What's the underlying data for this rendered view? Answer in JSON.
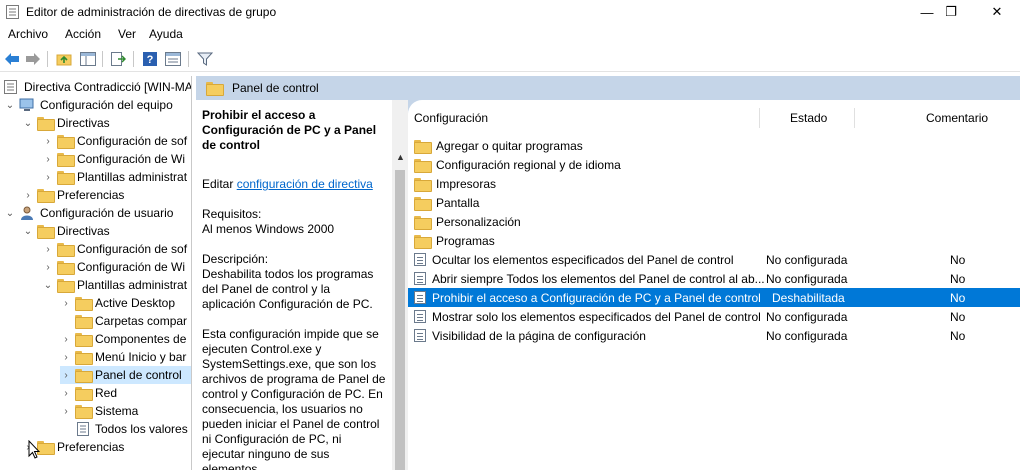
{
  "window": {
    "title": "Editor de administración de directivas de grupo",
    "minimize": "—",
    "maximize": "❐",
    "close": "✕"
  },
  "menu": [
    "Archivo",
    "Acción",
    "Ver",
    "Ayuda"
  ],
  "tree": [
    {
      "label": "Directiva Contradicció [WIN-MA",
      "indent": 0,
      "chevron": "",
      "icon": "policy"
    },
    {
      "label": "Configuración del equipo",
      "indent": 1,
      "chevron": "v",
      "icon": "computer"
    },
    {
      "label": "Directivas",
      "indent": 2,
      "chevron": "v",
      "icon": "folder"
    },
    {
      "label": "Configuración de sof",
      "indent": 3,
      "chevron": ">",
      "icon": "folder"
    },
    {
      "label": "Configuración de Wi",
      "indent": 3,
      "chevron": ">",
      "icon": "folder"
    },
    {
      "label": "Plantillas administrat",
      "indent": 3,
      "chevron": ">",
      "icon": "folder"
    },
    {
      "label": "Preferencias",
      "indent": 2,
      "chevron": ">",
      "icon": "folder"
    },
    {
      "label": "Configuración de usuario",
      "indent": 1,
      "chevron": "v",
      "icon": "user"
    },
    {
      "label": "Directivas",
      "indent": 2,
      "chevron": "v",
      "icon": "folder"
    },
    {
      "label": "Configuración de sof",
      "indent": 3,
      "chevron": ">",
      "icon": "folder"
    },
    {
      "label": "Configuración de Wi",
      "indent": 3,
      "chevron": ">",
      "icon": "folder"
    },
    {
      "label": "Plantillas administrat",
      "indent": 3,
      "chevron": "v",
      "icon": "folder"
    },
    {
      "label": "Active Desktop",
      "indent": 4,
      "chevron": ">",
      "icon": "folder"
    },
    {
      "label": "Carpetas compar",
      "indent": 4,
      "chevron": "",
      "icon": "folder"
    },
    {
      "label": "Componentes de",
      "indent": 4,
      "chevron": ">",
      "icon": "folder"
    },
    {
      "label": "Menú Inicio y bar",
      "indent": 4,
      "chevron": ">",
      "icon": "folder"
    },
    {
      "label": "Panel de control",
      "indent": 4,
      "chevron": ">",
      "icon": "folder",
      "selected": true
    },
    {
      "label": "Red",
      "indent": 4,
      "chevron": ">",
      "icon": "folder"
    },
    {
      "label": "Sistema",
      "indent": 4,
      "chevron": ">",
      "icon": "folder"
    },
    {
      "label": "Todos los valores",
      "indent": 4,
      "chevron": "",
      "icon": "settings"
    },
    {
      "label": "Preferencias",
      "indent": 2,
      "chevron": ">",
      "icon": "folder"
    }
  ],
  "banner": {
    "title": "Panel de control"
  },
  "description": {
    "title": "Prohibir el acceso a Configuración de PC y a Panel de control",
    "edit_prefix": "Editar",
    "edit_link": "configuración de directiva",
    "requirements_label": "Requisitos:",
    "requirements_value": "Al menos Windows 2000",
    "description_label": "Descripción:",
    "description_text": "Deshabilita todos los programas del Panel de control y la aplicación Configuración de PC.",
    "detail_text": "Esta configuración impide que se ejecuten Control.exe y SystemSettings.exe, que son los archivos de programa de Panel de control y Configuración de PC. En consecuencia, los usuarios no pueden iniciar el Panel de control ni Configuración de PC, ni ejecutar ninguno de sus elementos."
  },
  "list": {
    "headers": [
      "Configuración",
      "Estado",
      "Comentario"
    ],
    "rows": [
      {
        "name": "Agregar o quitar programas",
        "state": "",
        "comment": "",
        "type": "folder"
      },
      {
        "name": "Configuración regional y de idioma",
        "state": "",
        "comment": "",
        "type": "folder"
      },
      {
        "name": "Impresoras",
        "state": "",
        "comment": "",
        "type": "folder"
      },
      {
        "name": "Pantalla",
        "state": "",
        "comment": "",
        "type": "folder"
      },
      {
        "name": "Personalización",
        "state": "",
        "comment": "",
        "type": "folder"
      },
      {
        "name": "Programas",
        "state": "",
        "comment": "",
        "type": "folder"
      },
      {
        "name": "Ocultar los elementos especificados del Panel de control",
        "state": "No configurada",
        "comment": "No",
        "type": "setting"
      },
      {
        "name": "Abrir siempre Todos los elementos del Panel de control al ab...",
        "state": "No configurada",
        "comment": "No",
        "type": "setting"
      },
      {
        "name": "Prohibir el acceso a Configuración de PC y a Panel de control",
        "state": "Deshabilitada",
        "comment": "No",
        "type": "setting",
        "selected": true
      },
      {
        "name": "Mostrar solo los elementos especificados del Panel de control",
        "state": "No configurada",
        "comment": "No",
        "type": "setting"
      },
      {
        "name": "Visibilidad de la página de configuración",
        "state": "No configurada",
        "comment": "No",
        "type": "setting"
      }
    ]
  }
}
